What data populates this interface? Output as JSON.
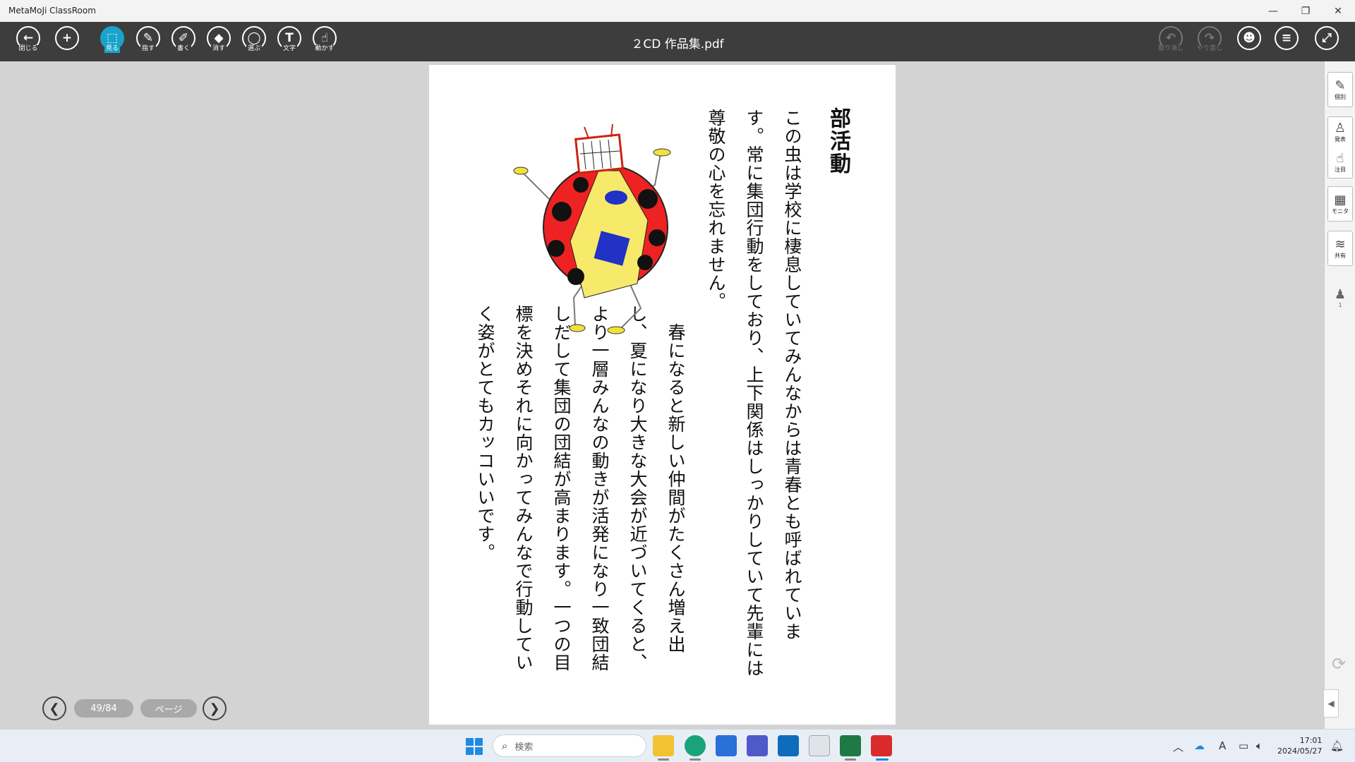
{
  "window": {
    "app_title": "MetaMoJi ClassRoom",
    "minimize_glyph": "—",
    "restore_glyph": "❐",
    "close_glyph": "✕"
  },
  "toolbar": {
    "doc_title": "２CD 作品集.pdf",
    "tools": [
      {
        "name": "close",
        "label": "閉じる",
        "glyph": "←"
      },
      {
        "name": "add",
        "label": "",
        "glyph": "+"
      },
      {
        "name": "view",
        "label": "見る",
        "glyph": "⬚"
      },
      {
        "name": "point",
        "label": "指す",
        "glyph": "✎"
      },
      {
        "name": "write",
        "label": "書く",
        "glyph": "✐"
      },
      {
        "name": "erase",
        "label": "消す",
        "glyph": "◆"
      },
      {
        "name": "select",
        "label": "選ぶ",
        "glyph": "◯"
      },
      {
        "name": "text",
        "label": "文字",
        "glyph": "T"
      },
      {
        "name": "move",
        "label": "動かす",
        "glyph": "☝"
      }
    ],
    "undo_label": "取り消し",
    "redo_label": "やり直し",
    "undo_glyph": "↶",
    "redo_glyph": "↷",
    "group_glyph": "☻",
    "menu_glyph": "≡",
    "expand_glyph": "⤢"
  },
  "document": {
    "heading": "部活動",
    "paragraph1": "この虫は学校に棲息していてみんなからは青春とも呼ばれていま\nす。常に集団行動をしており、上下関係はしっかりしていて先輩には\n尊敬の心を忘れません。",
    "paragraph2": "　春になると新しい仲間がたくさん増え出\nし、夏になり大きな大会が近づいてくると、\nより一層みんなの動きが活発になり一致団結\nしだして集団の団結が高まります。一つの目\n標を決めそれに向かってみんなで行動してい\nく姿がとてもカッコいいです。"
  },
  "right_panel": {
    "buttons": [
      {
        "label": "個別",
        "glyph": "✎"
      },
      {
        "label": "発表",
        "glyph": "♙"
      },
      {
        "label": "注目",
        "glyph": "☝"
      },
      {
        "label": "モニタ",
        "glyph": "▦"
      },
      {
        "label": "共有",
        "glyph": "≋"
      }
    ],
    "user_count": "1",
    "sync_glyph": "⟳",
    "collapse_glyph": "◀"
  },
  "page_nav": {
    "prev_glyph": "❮",
    "next_glyph": "❯",
    "page_indicator": "49/84",
    "page_button": "ページ"
  },
  "taskbar": {
    "search_placeholder": "検索",
    "time": "17:01",
    "date": "2024/05/27",
    "ime_glyph": "A"
  }
}
